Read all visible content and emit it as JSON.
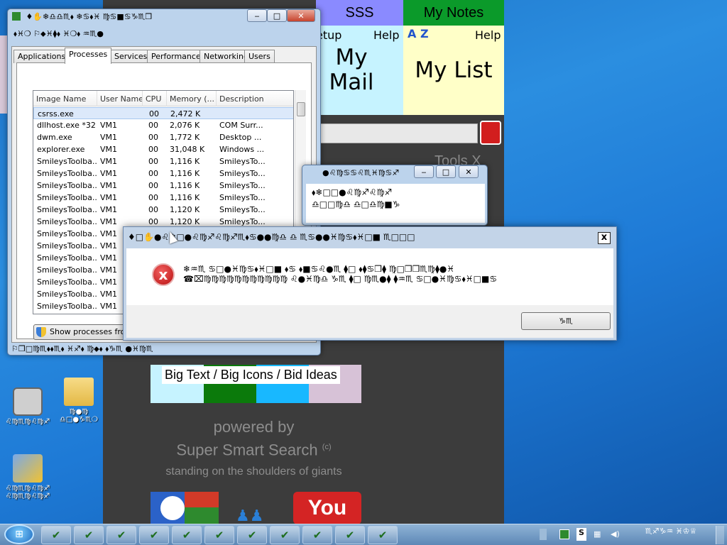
{
  "background_app": {
    "tiles": {
      "sss": "SSS",
      "my_notes": "My Notes",
      "setup_partial": "etup",
      "help_left": "Help",
      "help_right": "Help",
      "my_mail": "My Mail",
      "my_list": "My List",
      "az_icon": "A Z"
    },
    "tools": "Tools",
    "close_x": "X",
    "big_text_label": "Big Text / Big Icons / Bid Ideas",
    "powered_by": "powered by",
    "brand": "Super Smart Search",
    "copyright": "(c)",
    "tagline": "standing on the shoulders of giants",
    "youtube": "You"
  },
  "task_manager": {
    "title": "♦✋❄♎♎♏⬧ ❄♋⬧♓ ♍♋■♋♑♏❒",
    "menu": "⬧♓❍ ⚐⬥♓⧫⬧ ♓❍⬧ ♒♏●",
    "tabs": [
      "Applications",
      "Processes",
      "Services",
      "Performance",
      "Networking",
      "Users"
    ],
    "selected_tab": "Processes",
    "columns": [
      "Image Name",
      "User Name",
      "CPU",
      "Memory (...",
      "Description"
    ],
    "rows": [
      [
        "csrss.exe",
        "",
        "00",
        "2,472 K",
        ""
      ],
      [
        "dllhost.exe *32",
        "VM1",
        "00",
        "2,076 K",
        "COM Surr..."
      ],
      [
        "dwm.exe",
        "VM1",
        "00",
        "1,772 K",
        "Desktop ..."
      ],
      [
        "explorer.exe",
        "VM1",
        "00",
        "31,048 K",
        "Windows ..."
      ],
      [
        "SmileysToolba...",
        "VM1",
        "00",
        "1,116 K",
        "SmileysTo..."
      ],
      [
        "SmileysToolba...",
        "VM1",
        "00",
        "1,116 K",
        "SmileysTo..."
      ],
      [
        "SmileysToolba...",
        "VM1",
        "00",
        "1,116 K",
        "SmileysTo..."
      ],
      [
        "SmileysToolba...",
        "VM1",
        "00",
        "1,116 K",
        "SmileysTo..."
      ],
      [
        "SmileysToolba...",
        "VM1",
        "00",
        "1,120 K",
        "SmileysTo..."
      ],
      [
        "SmileysToolba...",
        "VM1",
        "00",
        "1,120 K",
        "SmileysTo..."
      ],
      [
        "SmileysToolba...",
        "VM1",
        "00",
        "1,116 K",
        "SmileysTo..."
      ],
      [
        "SmileysToolba...",
        "VM1",
        "",
        "",
        ""
      ],
      [
        "SmileysToolba...",
        "VM1",
        "",
        "",
        ""
      ],
      [
        "SmileysToolba...",
        "VM1",
        "",
        "",
        ""
      ],
      [
        "SmileysToolba...",
        "VM1",
        "",
        "",
        ""
      ],
      [
        "SmileysToolba...",
        "VM1",
        "",
        "",
        ""
      ],
      [
        "SmileysToolba...",
        "VM1",
        "",
        "",
        ""
      ]
    ],
    "show_processes_button": "Show processes from",
    "status_bar": "⚐❒□♍♏⬧⬧♏⬧ ♓♐⬧ ♍⬥⬧ ⬧♑♏ ●♓♍♏"
  },
  "small_dialog": {
    "title": "●♌♍♋♋♌♏♓♍♋♐",
    "line1": "⬧❄□□●♌♍♐♌♍♐",
    "line2": "♎□□♍♎ ♎□♎♍■♑"
  },
  "error_dialog": {
    "title": "♦□✋●♌❄□●♌♍♐♌♍♐♏⬧♋●●♍♎ ♎ ♏♋●●♓♍♋⬧♓□■ ♏□□□",
    "close": "x",
    "icon": "x",
    "message_line1": "❄♒♏ ♋□●♓♍♋⬧♓□■ ⬧♋ ⬧■♋♌●♏ ⧫□ ⬧⧫♋❒⧫ ♍□❒❒♏♍⧫●♓",
    "message_line2": "☎⌧♍♍♍♍♍♍♍♍♍♍♍ ♌●♓♍♎ ♑♏ ⧫□ ♍♏●⧫ ⧫♒♏ ♋□●♓♍♋⬧♓□■♋",
    "ok_button": "♑♏"
  },
  "desktop_icons": [
    {
      "label": "♌♍♏♍♌♍♐"
    },
    {
      "label": "♍●♍ ♎□●♑♏❍"
    },
    {
      "label": "♌♍♏♍♌♍♐ ♌♍♏♍♌♍♐"
    }
  ],
  "taskbar": {
    "start_icon": "windows-orb",
    "buttons": [
      "app",
      "app",
      "app",
      "app",
      "app",
      "app",
      "app",
      "app",
      "app",
      "app",
      "app"
    ],
    "tray_text": "♏♐♑♒ ♓♔♕"
  }
}
